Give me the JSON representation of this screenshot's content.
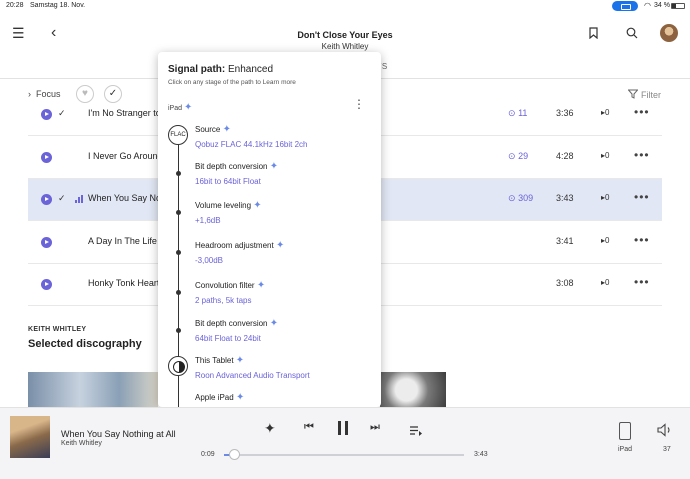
{
  "status": {
    "time": "20:28",
    "date": "Samstag 18. Nov.",
    "battery": "34 %"
  },
  "header": {
    "title": "Don't Close Your Eyes",
    "subtitle": "Keith Whitley",
    "tabs_partial": "OITS"
  },
  "toolbar": {
    "focus_label": "Focus",
    "filter_label": "Filter"
  },
  "tracks": [
    {
      "name": "I'm No Stranger to",
      "checked": true,
      "playing": false,
      "plays": "11",
      "duration": "3:36",
      "count": "0"
    },
    {
      "name": "I Never Go Around",
      "checked": false,
      "playing": false,
      "plays": "29",
      "duration": "4:28",
      "count": "0"
    },
    {
      "name": "When You Say Not",
      "checked": true,
      "playing": true,
      "plays": "309",
      "duration": "3:43",
      "count": "0"
    },
    {
      "name": "A Day In The Life C",
      "checked": false,
      "playing": false,
      "plays": "",
      "duration": "3:41",
      "count": "0"
    },
    {
      "name": "Honky Tonk Heart",
      "checked": false,
      "playing": false,
      "plays": "",
      "duration": "3:08",
      "count": "0"
    }
  ],
  "discography": {
    "artist": "KEITH WHITLEY",
    "title": "Selected discography"
  },
  "signal_path": {
    "title_prefix": "Signal path:",
    "title_quality": "Enhanced",
    "hint": "Click on any stage of the path to Learn more",
    "device": "iPad",
    "source_badge": "FLAC",
    "stages": [
      {
        "name": "Source",
        "detail": "Qobuz FLAC 44.1kHz 16bit 2ch"
      },
      {
        "name": "Bit depth conversion",
        "detail": "16bit to 64bit Float"
      },
      {
        "name": "Volume leveling",
        "detail": "+1,6dB"
      },
      {
        "name": "Headroom adjustment",
        "detail": "-3,00dB"
      },
      {
        "name": "Convolution filter",
        "detail": "2 paths, 5k taps"
      },
      {
        "name": "Bit depth conversion",
        "detail": "64bit Float to 24bit"
      },
      {
        "name": "This Tablet",
        "detail": "Roon Advanced Audio Transport"
      },
      {
        "name": "Apple iPad",
        "detail": ""
      }
    ]
  },
  "player": {
    "title": "When You Say Nothing at All",
    "artist": "Keith Whitley",
    "elapsed": "0:09",
    "total": "3:43",
    "progress": 0.04,
    "output": "iPad",
    "volume": "37"
  },
  "accent": "#6b63d8",
  "icons": [
    "menu-icon",
    "back-icon",
    "bookmark-icon",
    "search-icon",
    "chevron-right-icon",
    "heart-icon",
    "check-icon",
    "filter-icon",
    "play-icon",
    "radio-icon",
    "kebab-icon",
    "sparkle-icon",
    "previous-icon",
    "pause-icon",
    "next-icon",
    "queue-icon",
    "ipad-icon",
    "volume-icon"
  ]
}
